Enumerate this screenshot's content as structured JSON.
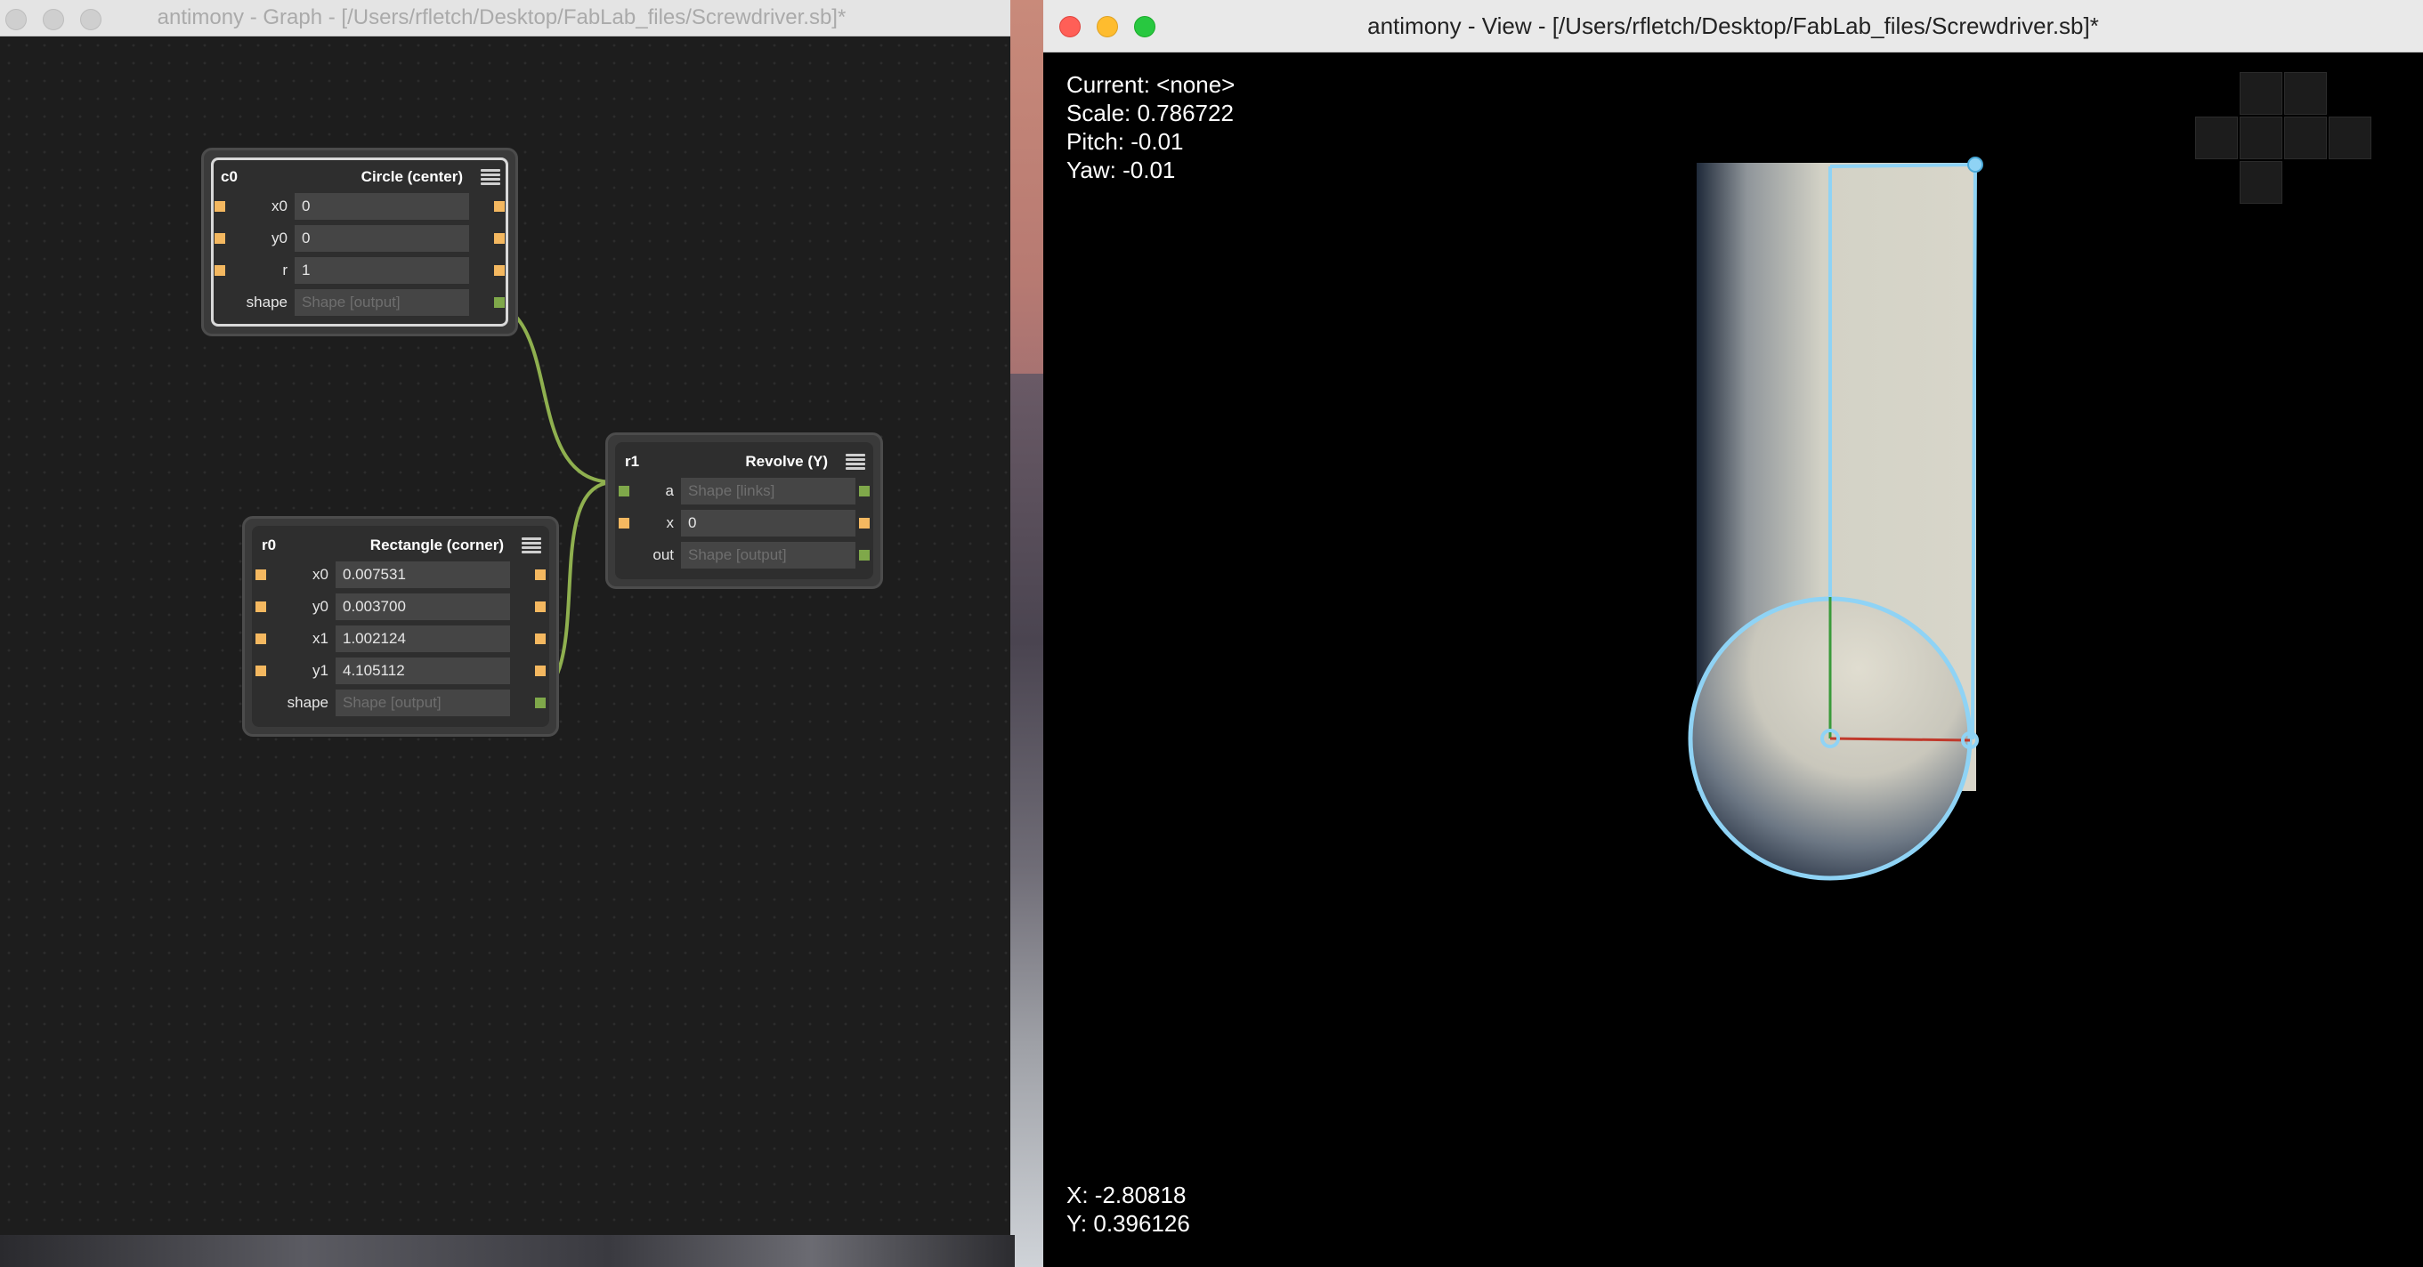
{
  "graph_window": {
    "title": "antimony - Graph - [/Users/rfletch/Desktop/FabLab_files/Screwdriver.sb]*"
  },
  "view_window": {
    "title": "antimony - View - [/Users/rfletch/Desktop/FabLab_files/Screwdriver.sb]*",
    "info": {
      "current": "Current: <none>",
      "scale": "Scale: 0.786722",
      "pitch": "Pitch: -0.01",
      "yaw": "Yaw: -0.01"
    },
    "cursor": {
      "x": "X: -2.80818",
      "y": "Y: 0.396126"
    }
  },
  "nodes": {
    "c0": {
      "name": "c0",
      "type": "Circle (center)",
      "rows": [
        {
          "label": "x0",
          "value": "0"
        },
        {
          "label": "y0",
          "value": "0"
        },
        {
          "label": "r",
          "value": "1"
        },
        {
          "label": "shape",
          "value": "Shape [output]"
        }
      ]
    },
    "r0": {
      "name": "r0",
      "type": "Rectangle (corner)",
      "rows": [
        {
          "label": "x0",
          "value": "0.007531"
        },
        {
          "label": "y0",
          "value": "0.003700"
        },
        {
          "label": "x1",
          "value": "1.002124"
        },
        {
          "label": "y1",
          "value": "4.105112"
        },
        {
          "label": "shape",
          "value": "Shape [output]"
        }
      ]
    },
    "r1": {
      "name": "r1",
      "type": "Revolve (Y)",
      "rows": [
        {
          "label": "a",
          "value": "Shape [links]"
        },
        {
          "label": "x",
          "value": "0"
        },
        {
          "label": "out",
          "value": "Shape [output]"
        }
      ]
    }
  },
  "colors": {
    "port_number": "#f4b860",
    "port_shape": "#7fa84a",
    "wire": "#8fb04f",
    "outline": "#8fd3f5",
    "axis_x": "#c0392b",
    "axis_y": "#3a9a3a",
    "traffic_close": "#ff5f57",
    "traffic_min": "#febc2e",
    "traffic_max": "#28c840"
  }
}
